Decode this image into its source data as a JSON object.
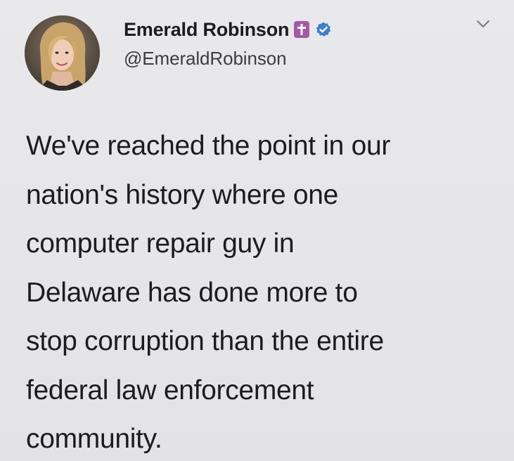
{
  "author": {
    "name": "Emerald Robinson",
    "handle": "@EmeraldRobinson",
    "badges": {
      "cross_badge_icon": "latin-cross-icon",
      "cross_badge_color": "#a35aa6",
      "verified_icon": "verified-badge-icon",
      "verified_color": "#3b7fd4"
    }
  },
  "menu": {
    "icon": "chevron-down-icon"
  },
  "tweet": {
    "lines": [
      "We've reached the point in our",
      "nation's history where one",
      "computer repair guy in",
      "Delaware has done more to",
      "stop corruption than the entire",
      "federal law enforcement",
      "community."
    ]
  }
}
